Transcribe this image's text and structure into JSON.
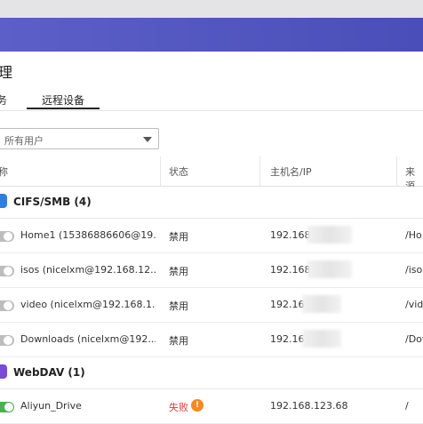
{
  "app": {
    "title_fragment": "理"
  },
  "tabs": [
    {
      "label": "务"
    },
    {
      "label": "远程设备",
      "active": true
    }
  ],
  "filter": {
    "selected": "所有用户"
  },
  "table": {
    "headers": [
      "称",
      "状态",
      "主机名/IP",
      "来源"
    ]
  },
  "groups": [
    {
      "label": "CIFS/SMB (4)",
      "icon": "cifs-share-icon",
      "color": "#2f7de1",
      "rows": [
        {
          "name": "Home1 (15386886606@19...",
          "status": "禁用",
          "host": "192.168",
          "mount": "/Ho",
          "enabled": false
        },
        {
          "name": "isos (nicelxm@192.168.12...",
          "status": "禁用",
          "host": "192.168",
          "mount": "/isos",
          "enabled": false
        },
        {
          "name": "video (nicelxm@192.168.1...",
          "status": "禁用",
          "host": "192.16",
          "mount": "/vid",
          "enabled": false
        },
        {
          "name": "Downloads (nicelxm@192....",
          "status": "禁用",
          "host": "192.16",
          "mount": "/Dov",
          "enabled": false
        }
      ]
    },
    {
      "label": "WebDAV (1)",
      "icon": "webdav-icon",
      "color": "#7a4ad8",
      "rows": [
        {
          "name": "Aliyun_Drive",
          "status": "失败",
          "host": "192.168.123.68",
          "mount": "/",
          "enabled": true,
          "warning_icon": "warning-icon",
          "status_color": "#e53935"
        }
      ]
    }
  ],
  "colors": {
    "banner": "#5b5fc7",
    "toggle_on": "#4caf50",
    "toggle_off": "#bdbdbd",
    "warning": "#f5891f"
  }
}
